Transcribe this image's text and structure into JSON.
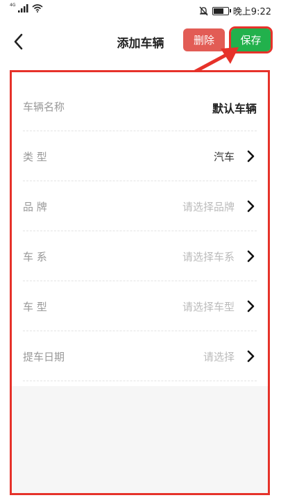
{
  "status_bar": {
    "network": "4G",
    "time": "晚上9:22"
  },
  "header": {
    "title": "添加车辆",
    "delete_label": "删除",
    "save_label": "保存"
  },
  "form": {
    "rows": [
      {
        "label": "车辆名称",
        "value": "默认车辆"
      },
      {
        "label": "类 型",
        "value": "汽车"
      },
      {
        "label": "品 牌",
        "placeholder": "请选择品牌"
      },
      {
        "label": "车 系",
        "placeholder": "请选择车系"
      },
      {
        "label": "车 型",
        "placeholder": "请选择车型"
      },
      {
        "label": "提车日期",
        "placeholder": "请选择"
      }
    ]
  },
  "colors": {
    "save": "#22b14c",
    "delete": "#e25c55",
    "highlight": "#e6322a"
  },
  "icons": [
    "back-arrow-icon",
    "chevron-right-icon",
    "signal-icon",
    "wifi-icon",
    "mute-icon",
    "battery-icon"
  ]
}
